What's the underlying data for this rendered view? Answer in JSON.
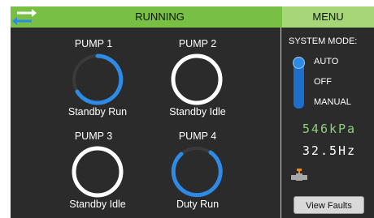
{
  "header": {
    "status": "RUNNING",
    "menu_label": "MENU"
  },
  "pumps": [
    {
      "title": "PUMP 1",
      "status": "Standby Run",
      "running": true
    },
    {
      "title": "PUMP 2",
      "status": "Standby Idle",
      "running": false
    },
    {
      "title": "PUMP 3",
      "status": "Standby Idle",
      "running": false
    },
    {
      "title": "PUMP 4",
      "status": "Duty Run",
      "running": true
    }
  ],
  "system_mode": {
    "label": "SYSTEM MODE:",
    "options": [
      "AUTO",
      "OFF",
      "MANUAL"
    ],
    "selected": "AUTO"
  },
  "readouts": {
    "pressure": "546kPa",
    "frequency": "32.5Hz"
  },
  "actions": {
    "view_faults": "View Faults"
  },
  "colors": {
    "running_blue": "#2d8be6",
    "header_green": "#77c043",
    "menu_green": "#a6d678",
    "pressure_green": "#8ad07a",
    "valve_orange": "#f08a1e"
  },
  "icons": {
    "swap": "swap-arrows-icon",
    "valve": "valve-icon"
  }
}
